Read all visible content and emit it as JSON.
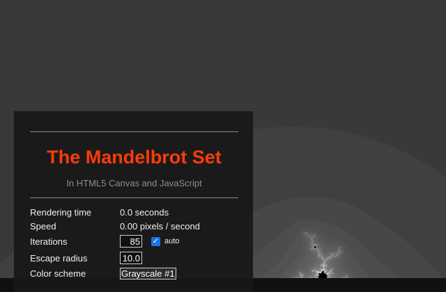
{
  "app": {
    "title": "The Mandelbrot Set",
    "subtitle": "In HTML5 Canvas and JavaScript"
  },
  "stats": {
    "rendering_time": {
      "label": "Rendering time",
      "value": "0.0 seconds"
    },
    "speed": {
      "label": "Speed",
      "value": "0.00 pixels / second"
    }
  },
  "controls": {
    "iterations": {
      "label": "Iterations",
      "value": "85",
      "auto_label": "auto",
      "auto_checked": true
    },
    "escape_radius": {
      "label": "Escape radius",
      "value": "10.0"
    },
    "color_scheme": {
      "label": "Color scheme",
      "value": "Grayscale #1"
    }
  },
  "colors": {
    "title": "#ff3b0a",
    "background": "#101010",
    "panel": "#181818",
    "checkbox": "#1a73e8"
  }
}
